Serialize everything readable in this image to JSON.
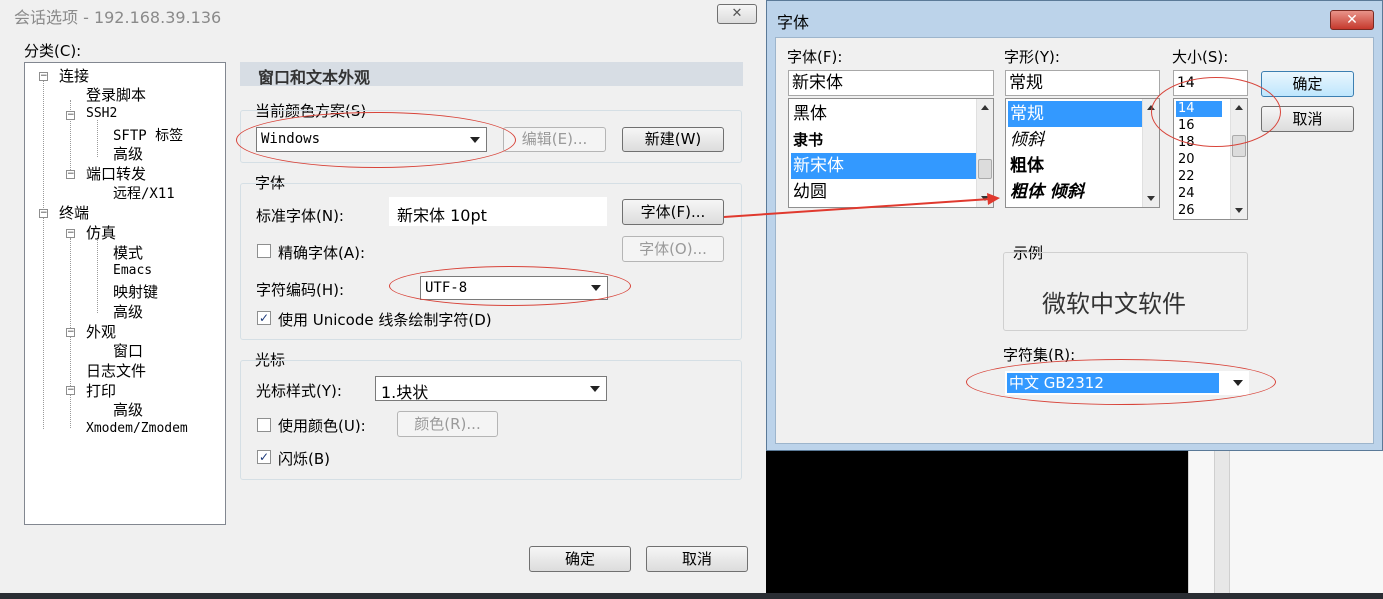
{
  "session": {
    "title": "会话选项 - 192.168.39.136",
    "close_symbol": "✕",
    "category_label": "分类(C):",
    "tree": [
      {
        "label": "连接"
      },
      {
        "label": "登录脚本"
      },
      {
        "label": "SSH2"
      },
      {
        "label": "SFTP 标签"
      },
      {
        "label": "高级"
      },
      {
        "label": "端口转发"
      },
      {
        "label": "远程/X11"
      },
      {
        "label": "终端"
      },
      {
        "label": "仿真"
      },
      {
        "label": "模式"
      },
      {
        "label": "Emacs"
      },
      {
        "label": "映射键"
      },
      {
        "label": "高级"
      },
      {
        "label": "外观"
      },
      {
        "label": "窗口"
      },
      {
        "label": "日志文件"
      },
      {
        "label": "打印"
      },
      {
        "label": "高级"
      },
      {
        "label": "Xmodem/Zmodem"
      }
    ],
    "section_header": "窗口和文本外观",
    "color_scheme_label": "当前颜色方案(S)",
    "color_scheme_value": "Windows",
    "edit_button": "编辑(E)...",
    "new_button": "新建(W)",
    "font_group": "字体",
    "normal_font_label": "标准字体(N):",
    "normal_font_value": "新宋体 10pt",
    "font_button": "字体(F)...",
    "precise_font_label": "精确字体(A):",
    "font_o_button": "字体(O)...",
    "encoding_label": "字符编码(H):",
    "encoding_value": "UTF-8",
    "unicode_label": "使用 Unicode 线条绘制字符(D)",
    "cursor_group": "光标",
    "cursor_style_label": "光标样式(Y):",
    "cursor_style_value": "1.块状",
    "use_color_label": "使用颜色(U):",
    "color_button": "颜色(R)...",
    "blink_label": "闪烁(B)",
    "ok_button": "确定",
    "cancel_button": "取消",
    "check_mark": "✓"
  },
  "font_dialog": {
    "title": "字体",
    "close_symbol": "✕",
    "font_label": "字体(F):",
    "font_value": "新宋体",
    "fonts": [
      "黑体",
      "隶书",
      "新宋体",
      "幼圆"
    ],
    "selected_font_index": 2,
    "style_label": "字形(Y):",
    "style_value": "常规",
    "styles": [
      "常规",
      "倾斜",
      "粗体",
      "粗体 倾斜"
    ],
    "selected_style_index": 0,
    "size_label": "大小(S):",
    "size_value": "14",
    "sizes": [
      "14",
      "16",
      "18",
      "20",
      "22",
      "24",
      "26"
    ],
    "selected_size_index": 0,
    "ok_button": "确定",
    "cancel_button": "取消",
    "sample_label": "示例",
    "sample_text": "微软中文软件",
    "charset_label": "字符集(R):",
    "charset_value": "中文 GB2312"
  },
  "colors": {
    "annotation": "#d8443a",
    "selection": "#3399ff",
    "section_header_bg": "#d7dde4"
  }
}
